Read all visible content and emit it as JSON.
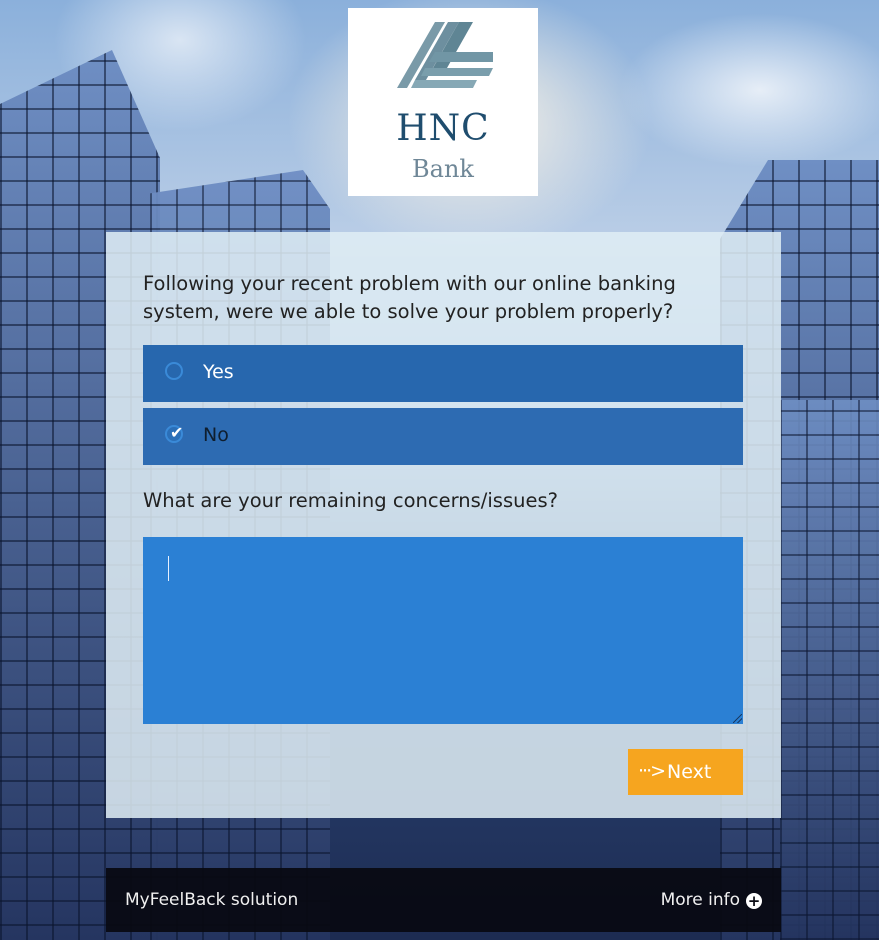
{
  "logo": {
    "name": "HNC",
    "subtitle": "Bank"
  },
  "survey": {
    "question_1": "Following your recent problem with our online banking system, were we able to solve your problem properly?",
    "options": [
      {
        "label": "Yes",
        "selected": false
      },
      {
        "label": "No",
        "selected": true
      }
    ],
    "question_2": "What are your remaining concerns/issues?",
    "answer_value": "",
    "next_label": "Next"
  },
  "footer": {
    "brand": "MyFeelBack solution",
    "more_info": "More info"
  },
  "colors": {
    "option_bg": "#2767ae",
    "textarea_bg": "#2b80d4",
    "next_button": "#f6a51f",
    "footer_bg": "#08090f",
    "logo_dark": "#1f4d6e",
    "logo_light": "#6f8797"
  },
  "icons": {
    "radio_unchecked": "radio-icon",
    "radio_checked": "check-icon",
    "next": "arrow-right-icon",
    "more_info": "plus-circle-icon"
  }
}
